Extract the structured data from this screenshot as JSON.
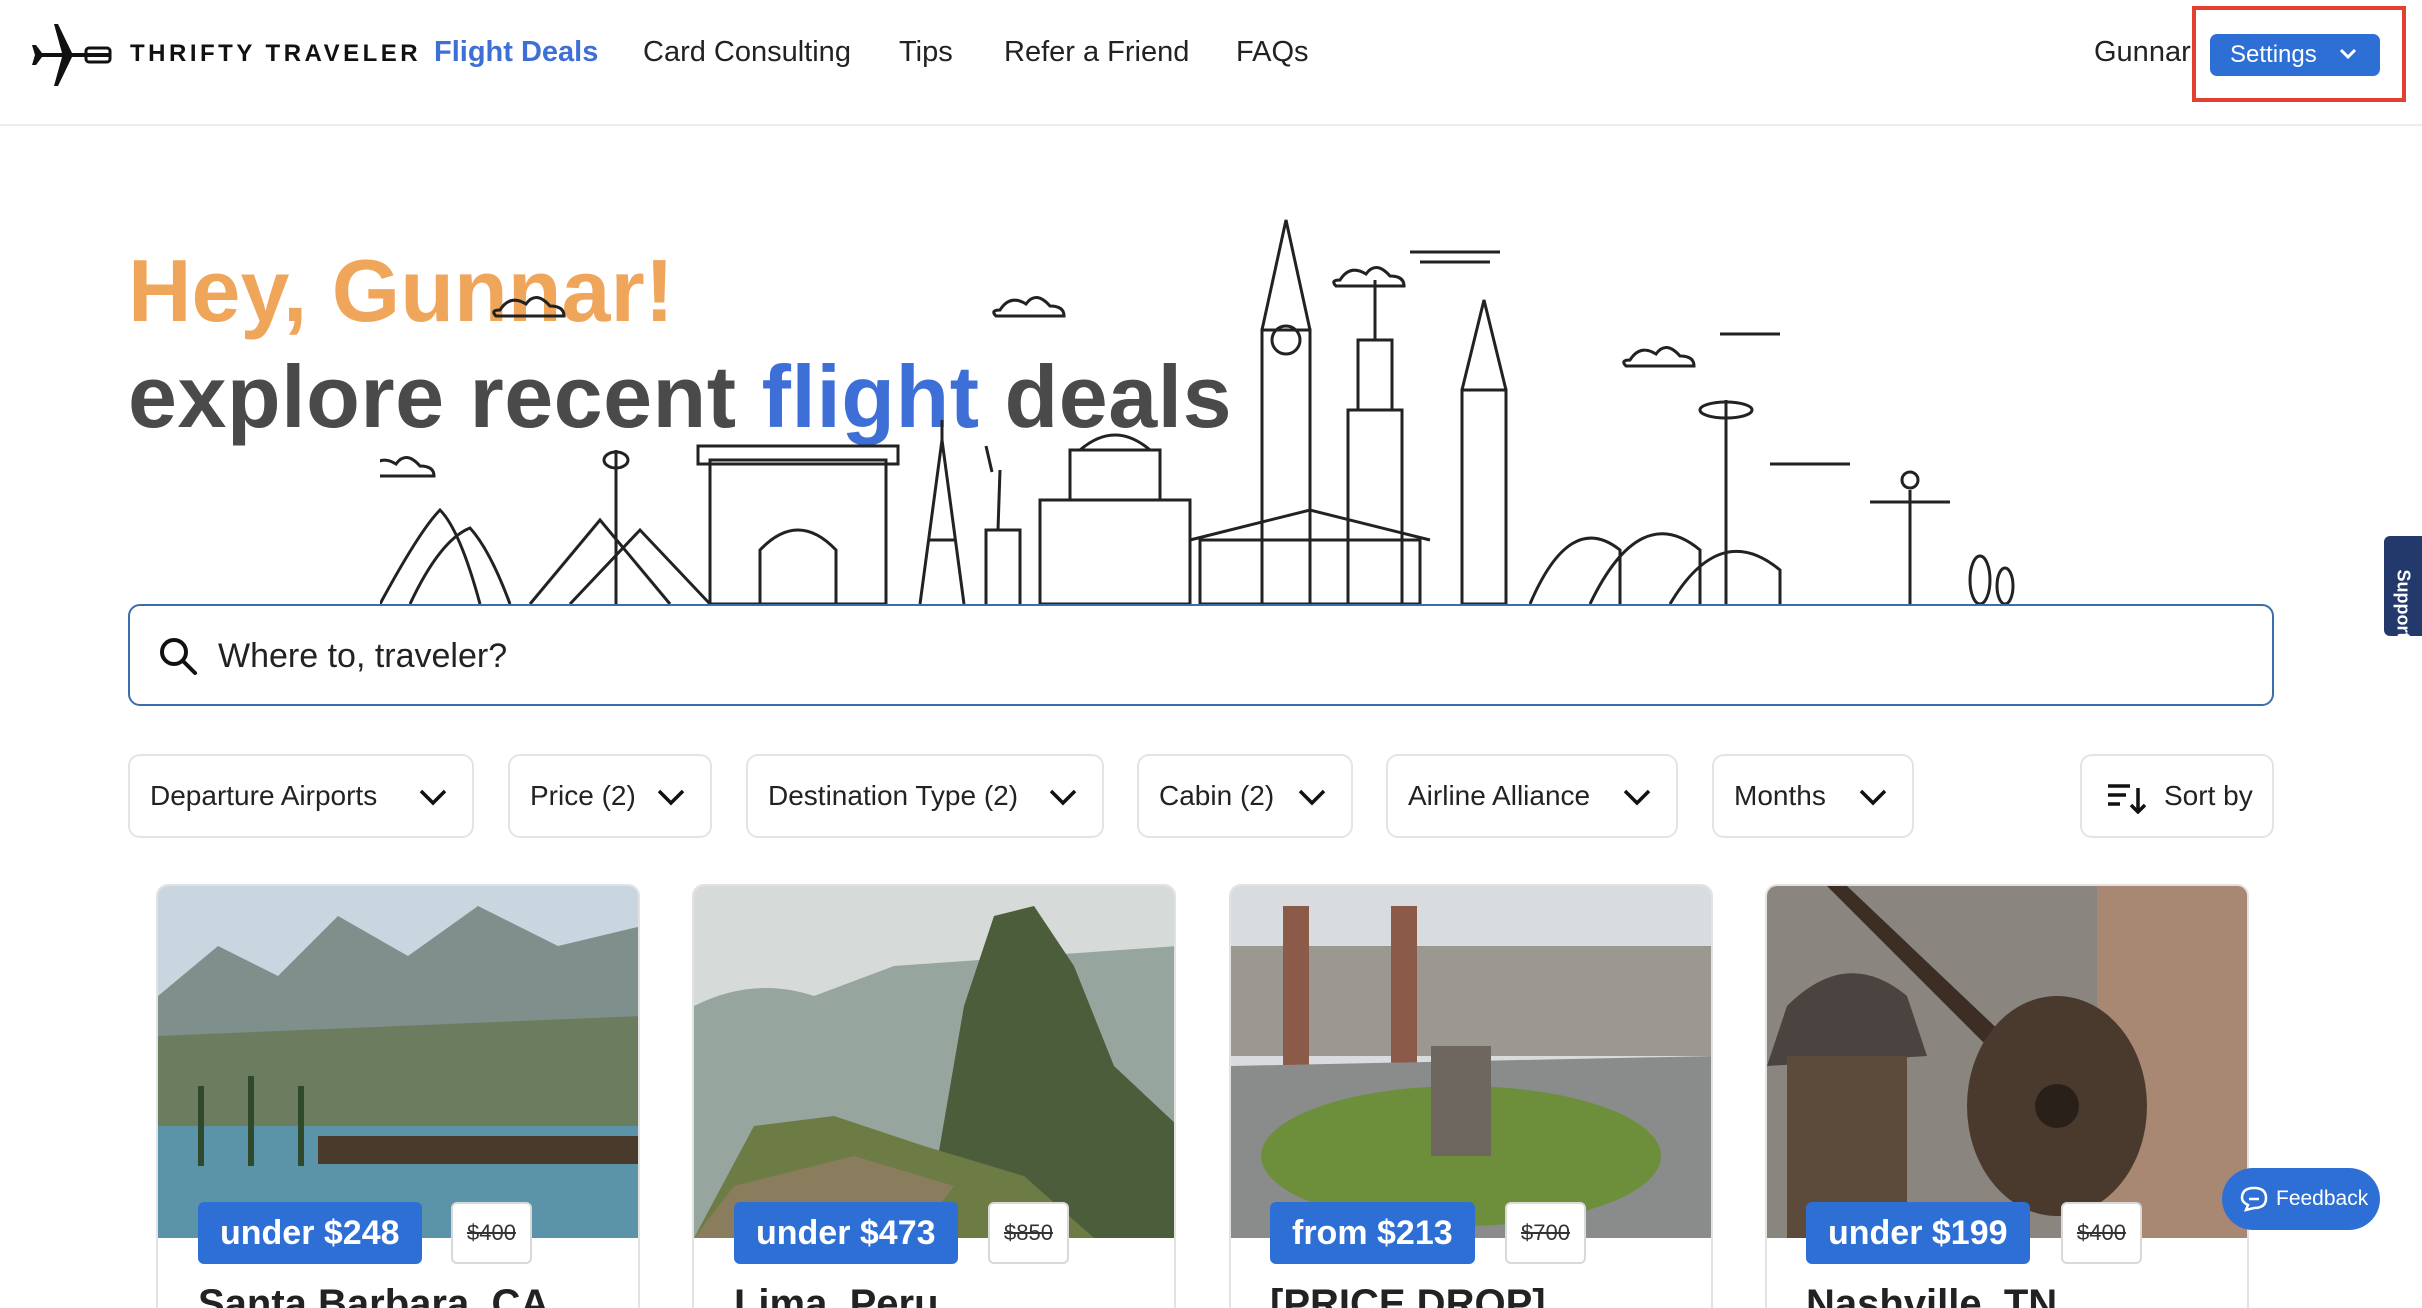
{
  "brand": {
    "name": "THRIFTY TRAVELER",
    "logo_icon": "plane-logo-icon"
  },
  "nav": {
    "items": [
      {
        "label": "Flight Deals",
        "active": true
      },
      {
        "label": "Card Consulting",
        "active": false
      },
      {
        "label": "Tips",
        "active": false
      },
      {
        "label": "Refer a Friend",
        "active": false
      },
      {
        "label": "FAQs",
        "active": false
      }
    ]
  },
  "user": {
    "name": "Gunnar",
    "settings_label": "Settings"
  },
  "hero": {
    "greeting": "Hey, Gunnar!",
    "tagline_start": "explore recent ",
    "tagline_accent": "flight",
    "tagline_end": " deals"
  },
  "search": {
    "placeholder": "Where to, traveler?",
    "value": ""
  },
  "filters": [
    {
      "label": "Departure Airports"
    },
    {
      "label": "Price (2)"
    },
    {
      "label": "Destination Type (2)"
    },
    {
      "label": "Cabin (2)"
    },
    {
      "label": "Airline Alliance"
    },
    {
      "label": "Months"
    }
  ],
  "sort": {
    "label": "Sort by"
  },
  "deals": [
    {
      "price": "under $248",
      "old_price": "$400",
      "title": "Santa Barbara, CA"
    },
    {
      "price": "under $473",
      "old_price": "$850",
      "title": "Lima, Peru"
    },
    {
      "price": "from $213",
      "old_price": "$700",
      "title": "[PRICE DROP]"
    },
    {
      "price": "under $199",
      "old_price": "$400",
      "title": "Nashville, TN"
    }
  ],
  "support": {
    "label": "Support"
  },
  "feedback": {
    "label": "Feedback"
  },
  "colors": {
    "accent": "#3d6fd6",
    "button_blue": "#2e6fd6",
    "greeting_orange": "#f0a65a",
    "highlight_red": "#e3402f",
    "support_navy": "#23396b"
  }
}
